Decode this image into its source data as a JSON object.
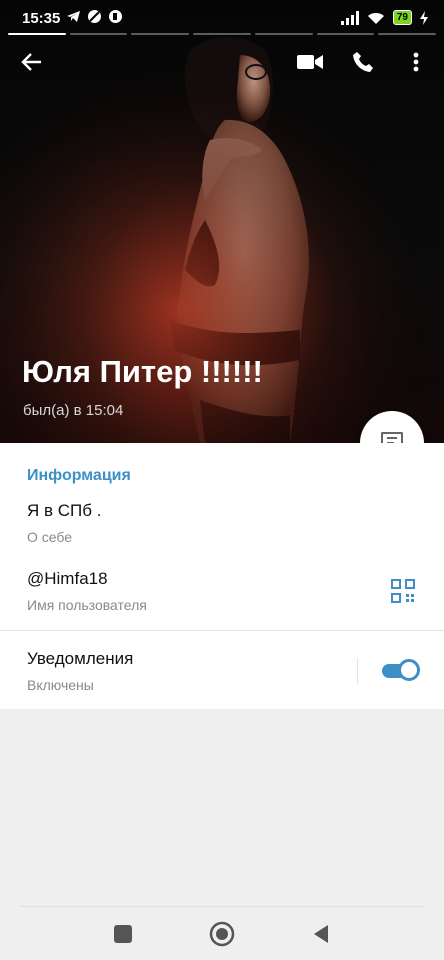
{
  "status_bar": {
    "time": "15:35",
    "battery": "79"
  },
  "toolbar": {
    "back_icon": "arrow-left-icon",
    "video_icon": "video-camera-icon",
    "call_icon": "phone-icon",
    "more_icon": "more-vertical-icon"
  },
  "profile": {
    "name": "Юля Питер !!!!!!",
    "last_seen": "был(а) в 15:04"
  },
  "info": {
    "section_title": "Информация",
    "bio_value": "Я в СПб .",
    "bio_label": "О себе",
    "username_value": "@Himfa18",
    "username_label": "Имя пользователя",
    "notifications_value": "Уведомления",
    "notifications_label": "Включены",
    "notifications_enabled": true
  },
  "colors": {
    "accent": "#3d8fc6"
  }
}
